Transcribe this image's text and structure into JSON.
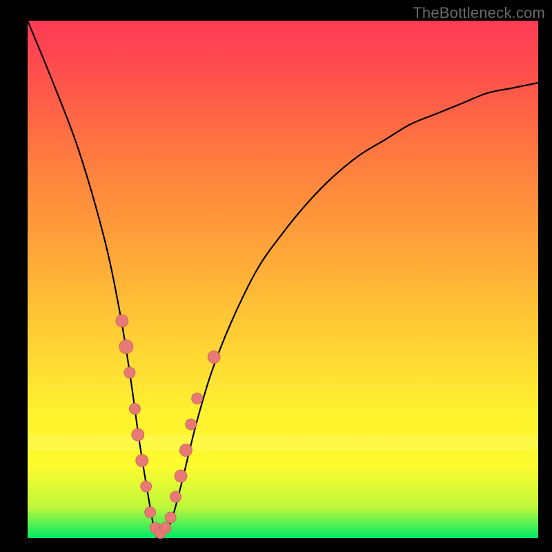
{
  "watermark": "TheBottleneck.com",
  "colors": {
    "gradient_top": "#ff3a56",
    "gradient_bottom": "#00e864",
    "curve": "#000000",
    "bead_fill": "#e77a75",
    "bead_stroke": "#c95e59",
    "frame": "#000000"
  },
  "chart_data": {
    "type": "line",
    "title": "",
    "xlabel": "",
    "ylabel": "",
    "xlim": [
      0,
      100
    ],
    "ylim": [
      0,
      100
    ],
    "series": [
      {
        "name": "bottleneck-curve",
        "x": [
          0,
          5,
          10,
          15,
          18,
          20,
          22,
          24,
          25,
          26,
          28,
          30,
          33,
          36,
          40,
          45,
          50,
          55,
          60,
          65,
          70,
          75,
          80,
          85,
          90,
          95,
          100
        ],
        "y": [
          100,
          88,
          75,
          58,
          44,
          32,
          18,
          6,
          1,
          0,
          3,
          10,
          22,
          32,
          42,
          52,
          59,
          65,
          70,
          74,
          77,
          80,
          82,
          84,
          86,
          87,
          88
        ]
      }
    ],
    "markers": [
      {
        "name": "left-cluster-1",
        "x": 18.5,
        "y": 42,
        "r": 9
      },
      {
        "name": "left-cluster-2",
        "x": 19.3,
        "y": 37,
        "r": 10
      },
      {
        "name": "left-cluster-3",
        "x": 20.0,
        "y": 32,
        "r": 8
      },
      {
        "name": "left-cluster-4",
        "x": 21.0,
        "y": 25,
        "r": 8
      },
      {
        "name": "left-cluster-5",
        "x": 21.6,
        "y": 20,
        "r": 9
      },
      {
        "name": "left-cluster-6",
        "x": 22.4,
        "y": 15,
        "r": 9
      },
      {
        "name": "left-cluster-7",
        "x": 23.2,
        "y": 10,
        "r": 8
      },
      {
        "name": "bottom-1",
        "x": 24.0,
        "y": 5,
        "r": 8
      },
      {
        "name": "bottom-2",
        "x": 25.0,
        "y": 2,
        "r": 8
      },
      {
        "name": "bottom-3",
        "x": 26.0,
        "y": 1,
        "r": 8
      },
      {
        "name": "bottom-4",
        "x": 27.0,
        "y": 2,
        "r": 8
      },
      {
        "name": "bottom-5",
        "x": 28.0,
        "y": 4,
        "r": 8
      },
      {
        "name": "right-cluster-1",
        "x": 29.0,
        "y": 8,
        "r": 8
      },
      {
        "name": "right-cluster-2",
        "x": 30.0,
        "y": 12,
        "r": 9
      },
      {
        "name": "right-cluster-3",
        "x": 31.0,
        "y": 17,
        "r": 9
      },
      {
        "name": "right-cluster-4",
        "x": 32.0,
        "y": 22,
        "r": 8
      },
      {
        "name": "right-cluster-5",
        "x": 33.2,
        "y": 27,
        "r": 8
      },
      {
        "name": "right-outlier",
        "x": 36.5,
        "y": 35,
        "r": 9
      }
    ],
    "notes": "Values are approximate, read from pixel positions; x and y in percent of plot area. y=0 at bottom, y=100 at top."
  }
}
